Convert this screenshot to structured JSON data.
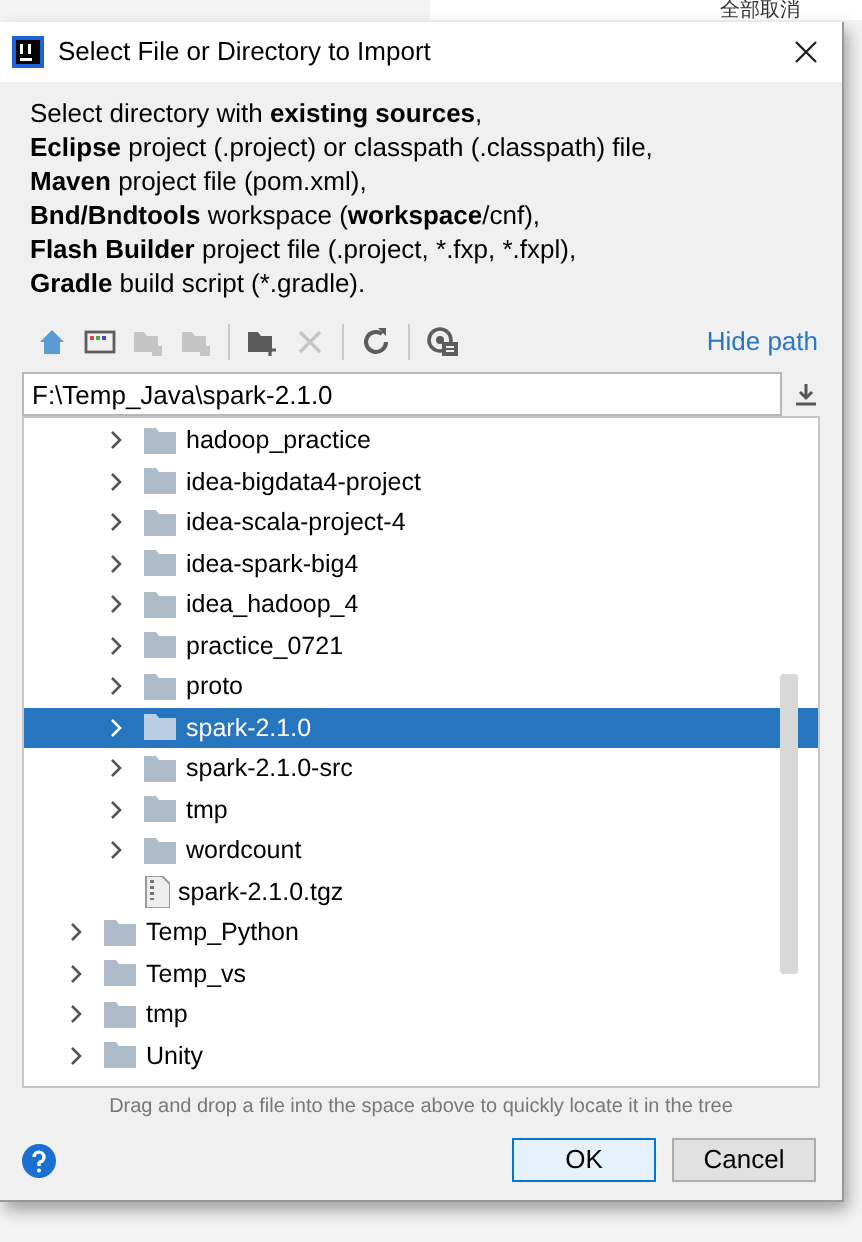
{
  "background": {
    "text": "全部取消"
  },
  "window": {
    "title": "Select File or Directory to Import"
  },
  "description": [
    "Select directory with **existing sources**,",
    "**Eclipse** project (.project) or classpath (.classpath) file,",
    "**Maven** project file (pom.xml),",
    "**Bnd/Bndtools** workspace (**workspace**/cnf),",
    "**Flash Builder** project file (.project, *.fxp, *.fxpl),",
    "**Gradle** build script (*.gradle)."
  ],
  "toolbar": [
    {
      "kind": "home",
      "disabled": false
    },
    {
      "kind": "desktop",
      "disabled": false
    },
    {
      "kind": "folder",
      "disabled": true
    },
    {
      "kind": "folder",
      "disabled": true
    },
    {
      "kind": "separator"
    },
    {
      "kind": "new-folder",
      "disabled": false
    },
    {
      "kind": "delete",
      "disabled": true
    },
    {
      "kind": "separator"
    },
    {
      "kind": "refresh",
      "disabled": false
    },
    {
      "kind": "separator"
    },
    {
      "kind": "hidden",
      "disabled": false
    }
  ],
  "hide_path_link": "Hide path",
  "path_field": {
    "value": "F:\\Temp_Java\\spark-2.1.0"
  },
  "tree": [
    {
      "children": [
        {
          "label": "hadoop_practice",
          "kind": "folder",
          "expanded": false,
          "selected": false
        },
        {
          "label": "idea-bigdata4-project",
          "kind": "folder",
          "expanded": false,
          "selected": false
        },
        {
          "label": "idea-scala-project-4",
          "kind": "folder",
          "expanded": false,
          "selected": false
        },
        {
          "label": "idea-spark-big4",
          "kind": "folder",
          "expanded": false,
          "selected": false
        },
        {
          "label": "idea_hadoop_4",
          "kind": "folder",
          "expanded": false,
          "selected": false
        },
        {
          "label": "practice_0721",
          "kind": "folder",
          "expanded": false,
          "selected": false
        },
        {
          "label": "proto",
          "kind": "folder",
          "expanded": false,
          "selected": false
        },
        {
          "label": "spark-2.1.0",
          "kind": "folder",
          "expanded": false,
          "selected": true
        },
        {
          "label": "spark-2.1.0-src",
          "kind": "folder",
          "expanded": false,
          "selected": false
        },
        {
          "label": "tmp",
          "kind": "folder",
          "expanded": false,
          "selected": false
        },
        {
          "label": "wordcount",
          "kind": "folder",
          "expanded": false,
          "selected": false
        },
        {
          "label": "spark-2.1.0.tgz",
          "kind": "file",
          "selected": false
        }
      ]
    },
    {
      "label": "Temp_Python",
      "kind": "folder",
      "expanded": false,
      "selected": false
    },
    {
      "label": "Temp_vs",
      "kind": "folder",
      "expanded": false,
      "selected": false
    },
    {
      "label": "tmp",
      "kind": "folder",
      "expanded": false,
      "selected": false
    },
    {
      "label": "Unity",
      "kind": "folder",
      "expanded": false,
      "selected": false
    }
  ],
  "hint": "Drag and drop a file into the space above to quickly locate it in the tree",
  "buttons": [
    {
      "label": "OK",
      "default": true
    },
    {
      "label": "Cancel",
      "default": false
    }
  ]
}
